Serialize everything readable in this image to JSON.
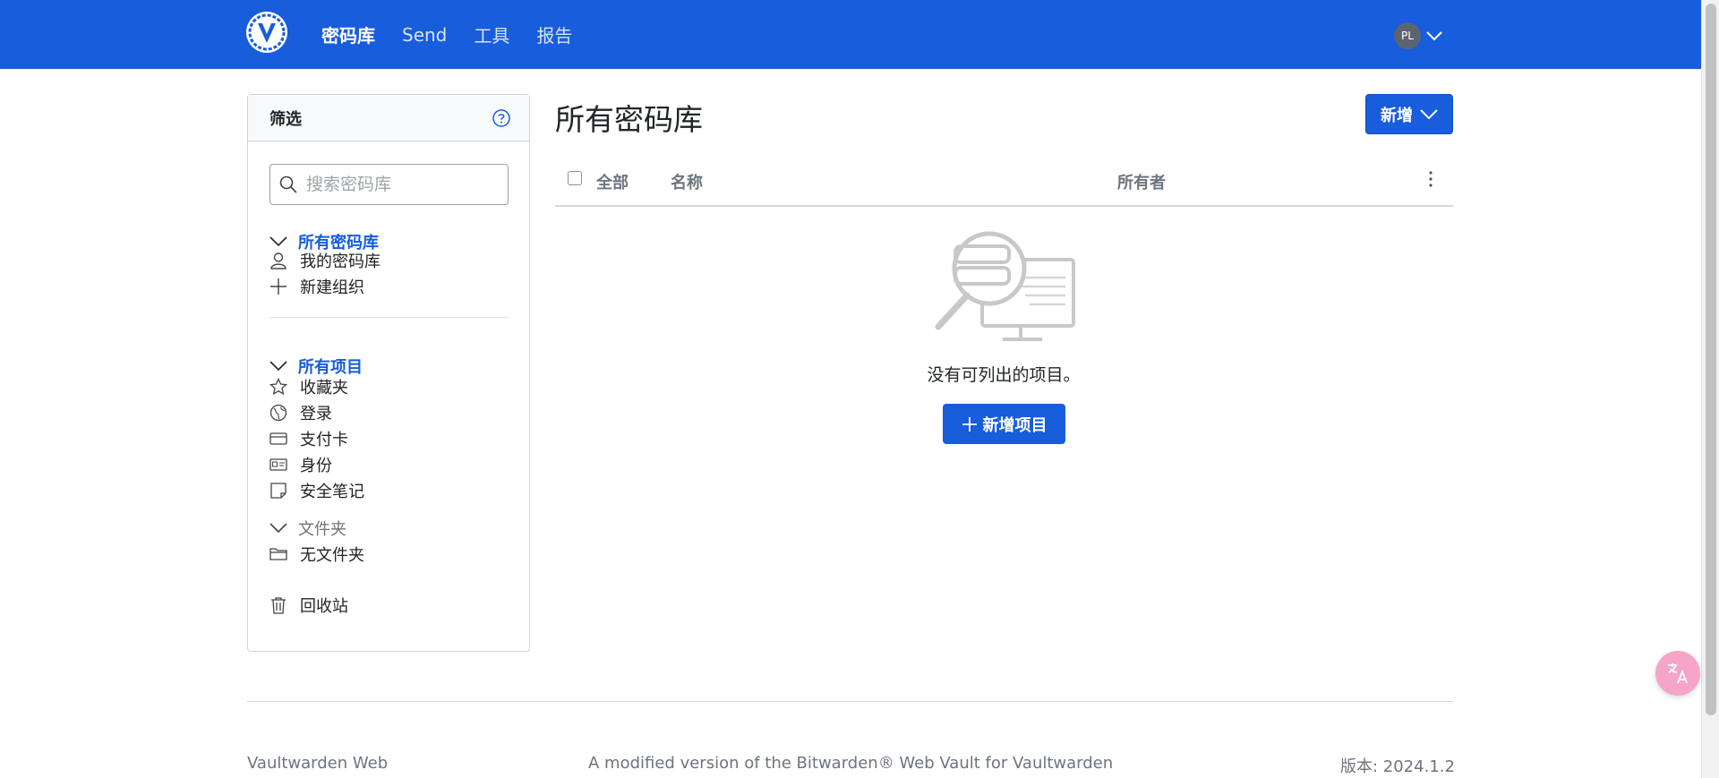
{
  "nav": {
    "links": [
      "密码库",
      "Send",
      "工具",
      "报告"
    ],
    "active_index": 0,
    "account_initials": "PL"
  },
  "filter": {
    "title": "筛选",
    "search_placeholder": "搜索密码库",
    "vaults_header": "所有密码库",
    "vault_items": [
      "我的密码库",
      "新建组织"
    ],
    "items_header": "所有项目",
    "type_items": [
      "收藏夹",
      "登录",
      "支付卡",
      "身份",
      "安全笔记"
    ],
    "folders_header": "文件夹",
    "folder_items": [
      "无文件夹"
    ],
    "trash": "回收站"
  },
  "main": {
    "title": "所有密码库",
    "new_button": "新增",
    "table_headers": {
      "all": "全部",
      "name": "名称",
      "owner": "所有者"
    },
    "empty_text": "没有可列出的项目。",
    "add_item_button": "新增项目"
  },
  "footer": {
    "left": "Vaultwarden Web",
    "center": "A modified version of the Bitwarden® Web Vault for Vaultwarden",
    "right": "版本: 2024.1.2"
  },
  "colors": {
    "brand": "#175ddc",
    "muted": "#6c757d"
  }
}
